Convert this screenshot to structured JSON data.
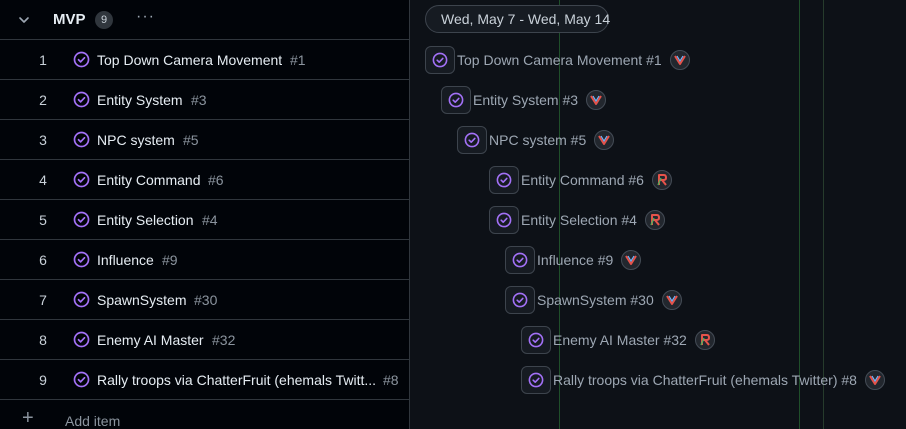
{
  "group": {
    "title": "MVP",
    "count": "9"
  },
  "timeline": {
    "date_range": "Wed, May 7 - Wed, May 14"
  },
  "add_item_label": "Add item",
  "colors": {
    "accent": "#a371f7",
    "border": "#30363d",
    "today_line": "#2ea043"
  },
  "items": [
    {
      "num": "1",
      "title": "Top Down Camera Movement",
      "issue": "#1",
      "bar_label": "Top Down Camera Movement #1",
      "avatar": "v-avatar-icon"
    },
    {
      "num": "2",
      "title": "Entity System",
      "issue": "#3",
      "bar_label": "Entity System #3",
      "avatar": "v-avatar-icon"
    },
    {
      "num": "3",
      "title": "NPC system",
      "issue": "#5",
      "bar_label": "NPC system #5",
      "avatar": "v-avatar-icon"
    },
    {
      "num": "4",
      "title": "Entity Command",
      "issue": "#6",
      "bar_label": "Entity Command #6",
      "avatar": "r-avatar-icon"
    },
    {
      "num": "5",
      "title": "Entity Selection",
      "issue": "#4",
      "bar_label": "Entity Selection #4",
      "avatar": "r-avatar-icon"
    },
    {
      "num": "6",
      "title": "Influence",
      "issue": "#9",
      "bar_label": "Influence #9",
      "avatar": "v-avatar-icon"
    },
    {
      "num": "7",
      "title": "SpawnSystem",
      "issue": "#30",
      "bar_label": "SpawnSystem #30",
      "avatar": "v-avatar-icon"
    },
    {
      "num": "8",
      "title": "Enemy AI Master",
      "issue": "#32",
      "bar_label": "Enemy AI Master #32",
      "avatar": "r-avatar-icon"
    },
    {
      "num": "9",
      "title": "Rally troops via ChatterFruit (ehemals Twitt...",
      "issue": "#8",
      "bar_label": "Rally troops via ChatterFruit (ehemals Twitter) #8",
      "avatar": "v-avatar-icon"
    }
  ]
}
